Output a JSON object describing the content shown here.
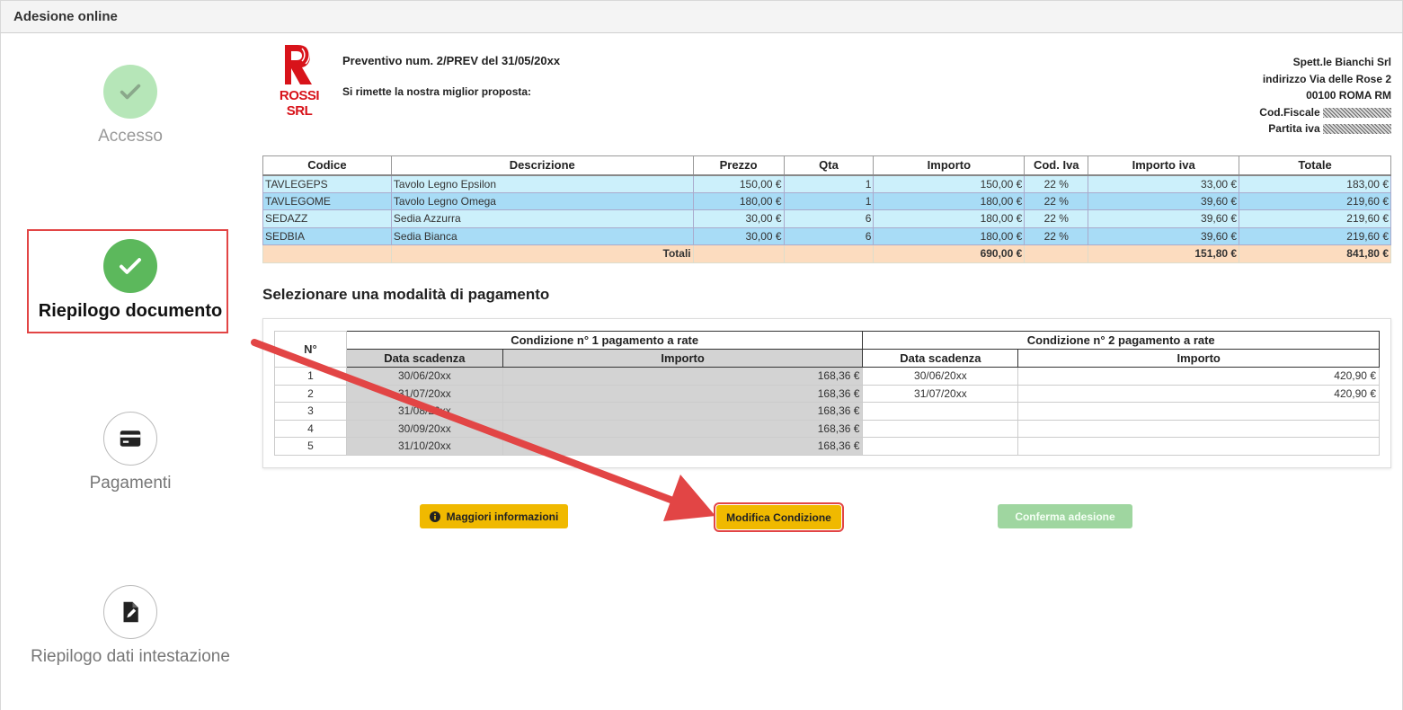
{
  "header": {
    "title": "Adesione online"
  },
  "steps": [
    {
      "label": "Accesso",
      "state": "done",
      "icon": "check-icon"
    },
    {
      "label": "Riepilogo documento",
      "state": "active",
      "icon": "check-icon"
    },
    {
      "label": "Pagamenti",
      "state": "todo",
      "icon": "credit-card-icon"
    },
    {
      "label": "Riepilogo dati intestazione",
      "state": "todo",
      "icon": "document-edit-icon"
    }
  ],
  "company": {
    "logo_text": "ROSSI SRL",
    "logo_color": "#d8131a"
  },
  "document": {
    "title": "Preventivo num. 2/PREV del 31/05/20xx",
    "subtitle": "Si rimette la nostra miglior proposta:"
  },
  "recipient": {
    "name": "Spett.le Bianchi Srl",
    "address": "indirizzo Via delle Rose 2",
    "city": "00100 ROMA RM",
    "cf_label": "Cod.Fiscale",
    "piva_label": "Partita iva"
  },
  "items": {
    "headers": [
      "Codice",
      "Descrizione",
      "Prezzo",
      "Qta",
      "Importo",
      "Cod. Iva",
      "Importo iva",
      "Totale"
    ],
    "rows": [
      [
        "TAVLEGEPS",
        "Tavolo Legno Epsilon",
        "150,00 €",
        "1",
        "150,00 €",
        "22 %",
        "33,00 €",
        "183,00 €"
      ],
      [
        "TAVLEGOME",
        "Tavolo Legno Omega",
        "180,00 €",
        "1",
        "180,00 €",
        "22 %",
        "39,60 €",
        "219,60 €"
      ],
      [
        "SEDAZZ",
        "Sedia Azzurra",
        "30,00 €",
        "6",
        "180,00 €",
        "22 %",
        "39,60 €",
        "219,60 €"
      ],
      [
        "SEDBIA",
        "Sedia Bianca",
        "30,00 €",
        "6",
        "180,00 €",
        "22 %",
        "39,60 €",
        "219,60 €"
      ]
    ],
    "totals": {
      "label": "Totali",
      "importo": "690,00 €",
      "importo_iva": "151,80 €",
      "totale": "841,80 €"
    }
  },
  "payment": {
    "section_title": "Selezionare una modalità di pagamento",
    "n_header": "N°",
    "cond1": "Condizione n° 1 pagamento a rate",
    "cond2": "Condizione n° 2 pagamento a rate",
    "date_header": "Data scadenza",
    "amount_header": "Importo",
    "rows": [
      {
        "n": "1",
        "d1": "30/06/20xx",
        "a1": "168,36 €",
        "d2": "30/06/20xx",
        "a2": "420,90 €"
      },
      {
        "n": "2",
        "d1": "31/07/20xx",
        "a1": "168,36 €",
        "d2": "31/07/20xx",
        "a2": "420,90 €"
      },
      {
        "n": "3",
        "d1": "31/08/20xx",
        "a1": "168,36 €",
        "d2": "",
        "a2": ""
      },
      {
        "n": "4",
        "d1": "30/09/20xx",
        "a1": "168,36 €",
        "d2": "",
        "a2": ""
      },
      {
        "n": "5",
        "d1": "31/10/20xx",
        "a1": "168,36 €",
        "d2": "",
        "a2": ""
      }
    ]
  },
  "buttons": {
    "info": "Maggiori informazioni",
    "modify": "Modifica Condizione",
    "confirm": "Conferma adesione"
  },
  "colors": {
    "accent_yellow": "#f0b900",
    "success": "#5cb85c",
    "annotation_red": "#e24545"
  }
}
